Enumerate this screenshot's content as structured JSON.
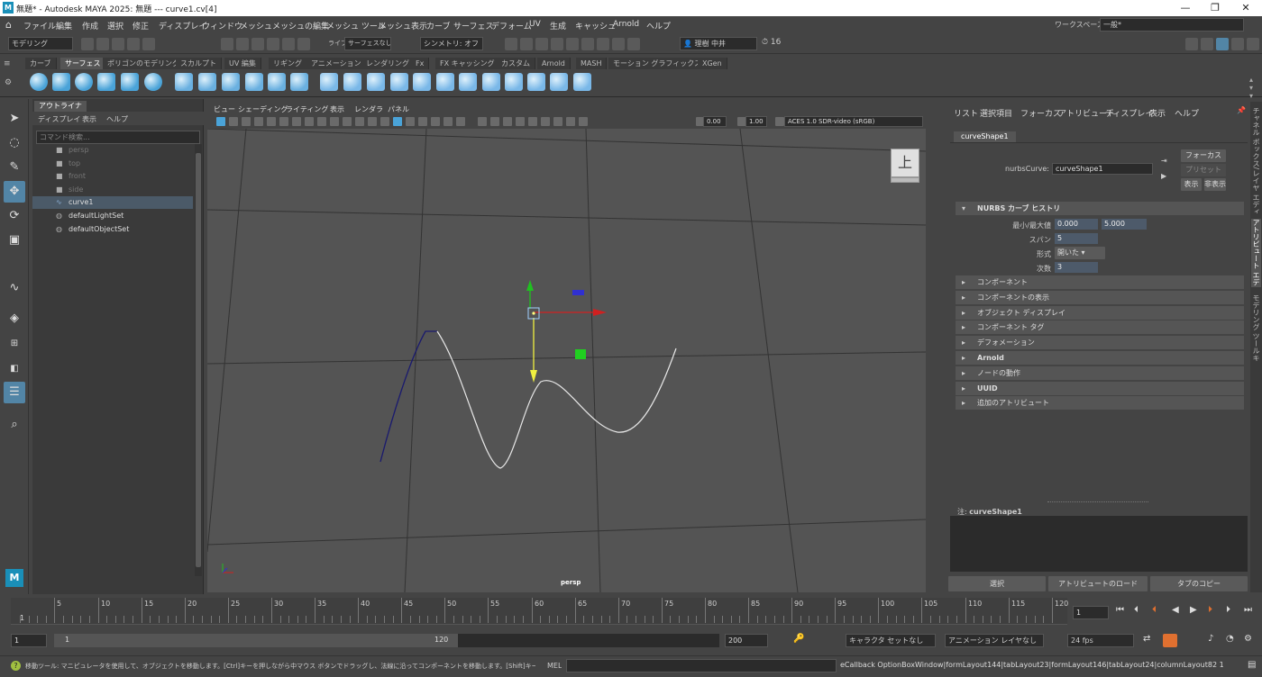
{
  "title_bar": {
    "title": "無題* - Autodesk MAYA 2025: 無題   ---   curve1.cv[4]",
    "logo": "M"
  },
  "menu": [
    "ファイル",
    "編集",
    "作成",
    "選択",
    "修正",
    "ディスプレイ",
    "ウィンドウ",
    "メッシュ",
    "メッシュの編集",
    "メッシュ ツール",
    "メッシュ表示",
    "カーブ",
    "サーフェス",
    "デフォーム",
    "UV",
    "生成",
    "キャッシュ",
    "Arnold",
    "ヘルプ"
  ],
  "workspace": {
    "label": "ワークスペース :",
    "value": "一般*"
  },
  "status_line": {
    "mode": "モデリング",
    "live_label": "ライブ",
    "live_value": "サーフェスなし",
    "symmetry": "シンメトリ: オフ",
    "user": "理樹 中井",
    "notifications": "16"
  },
  "shelf": {
    "tabs": [
      "カーブ",
      "サーフェス",
      "ポリゴンのモデリング",
      "スカルプト",
      "UV 編集",
      "リギング",
      "アニメーション",
      "レンダリング",
      "Fx",
      "FX キャッシング",
      "カスタム",
      "Arnold",
      "MASH",
      "モーション グラフィックス",
      "XGen"
    ],
    "active_tab": "サーフェス"
  },
  "outliner": {
    "tab": "アウトライナ",
    "menu": [
      "ディスプレイ",
      "表示",
      "ヘルプ"
    ],
    "search_placeholder": "コマンド検索...",
    "items": [
      {
        "label": "persp",
        "icon": "camera-icon",
        "dim": true
      },
      {
        "label": "top",
        "icon": "camera-icon",
        "dim": true
      },
      {
        "label": "front",
        "icon": "camera-icon",
        "dim": true
      },
      {
        "label": "side",
        "icon": "camera-icon",
        "dim": true
      },
      {
        "label": "curve1",
        "icon": "curve-icon",
        "dim": false,
        "selected": true
      },
      {
        "label": "defaultLightSet",
        "icon": "set-icon",
        "dim": false
      },
      {
        "label": "defaultObjectSet",
        "icon": "set-icon",
        "dim": false
      }
    ]
  },
  "viewport": {
    "menu": [
      "ビュー",
      "シェーディング",
      "ライティング",
      "表示",
      "レンダラ",
      "パネル"
    ],
    "exposure": "0.00",
    "gamma": "1.00",
    "colorspace": "ACES 1.0 SDR-video (sRGB)",
    "view_cube": "上",
    "camera_label": "persp"
  },
  "attribute_editor": {
    "menu": [
      "リスト",
      "選択項目",
      "フォーカス",
      "アトリビュート",
      "ディスプレイ",
      "表示",
      "ヘルプ"
    ],
    "tab": "curveShape1",
    "node_label": "nurbsCurve:",
    "node_value": "curveShape1",
    "focus_button": "フォーカス",
    "preset_button": "プリセット",
    "show_button": "表示",
    "hide_button": "非表示",
    "history_section": "NURBS カーブ ヒストリ",
    "fields": {
      "minmax_label": "最小/最大値",
      "min": "0.000",
      "max": "5.000",
      "spans_label": "スパン",
      "spans": "5",
      "form_label": "形式",
      "form": "開いた",
      "degree_label": "次数",
      "degree": "3"
    },
    "sections": [
      "コンポーネント",
      "コンポーネントの表示",
      "オブジェクト ディスプレイ",
      "コンポーネント タグ",
      "デフォメーション",
      "Arnold",
      "ノードの動作",
      "UUID",
      "追加のアトリビュート"
    ],
    "notes_label": "注:",
    "notes_node": "curveShape1",
    "bottom_buttons": [
      "選択",
      "アトリビュートのロード",
      "タブのコピー"
    ]
  },
  "right_tabs": [
    "チャネル ボックス/レイヤ エディタ",
    "アトリビュート エディタ",
    "モデリング ツールキット"
  ],
  "timeline": {
    "ticks": [
      "5",
      "10",
      "15",
      "20",
      "25",
      "30",
      "35",
      "40",
      "45",
      "50",
      "55",
      "60",
      "65",
      "70",
      "75",
      "80",
      "85",
      "90",
      "95",
      "100",
      "105",
      "110",
      "115",
      "120"
    ],
    "start_frame": "1",
    "current_frame": "1"
  },
  "range": {
    "start": "1",
    "inner_start": "1",
    "inner_end": "120",
    "end": "200",
    "character_set": "キャラクタ セットなし",
    "anim_layer": "アニメーション レイヤなし",
    "fps": "24 fps"
  },
  "help_line": "移動ツール: マニピュレータを使用して、オブジェクトを移動します。[Ctrl]キーを押しながら中マウス ボタンでドラッグし、法線に沿ってコンポーネントを移動します。[Shift]キーを押しながらマニ",
  "command": {
    "label": "MEL",
    "result": "eCallback OptionBoxWindow|formLayout144|tabLayout23|formLayout146|tabLayout24|columnLayout82 1"
  },
  "colors": {
    "accent": "#5285a6",
    "viewport": "#545454",
    "panel": "#444444"
  }
}
